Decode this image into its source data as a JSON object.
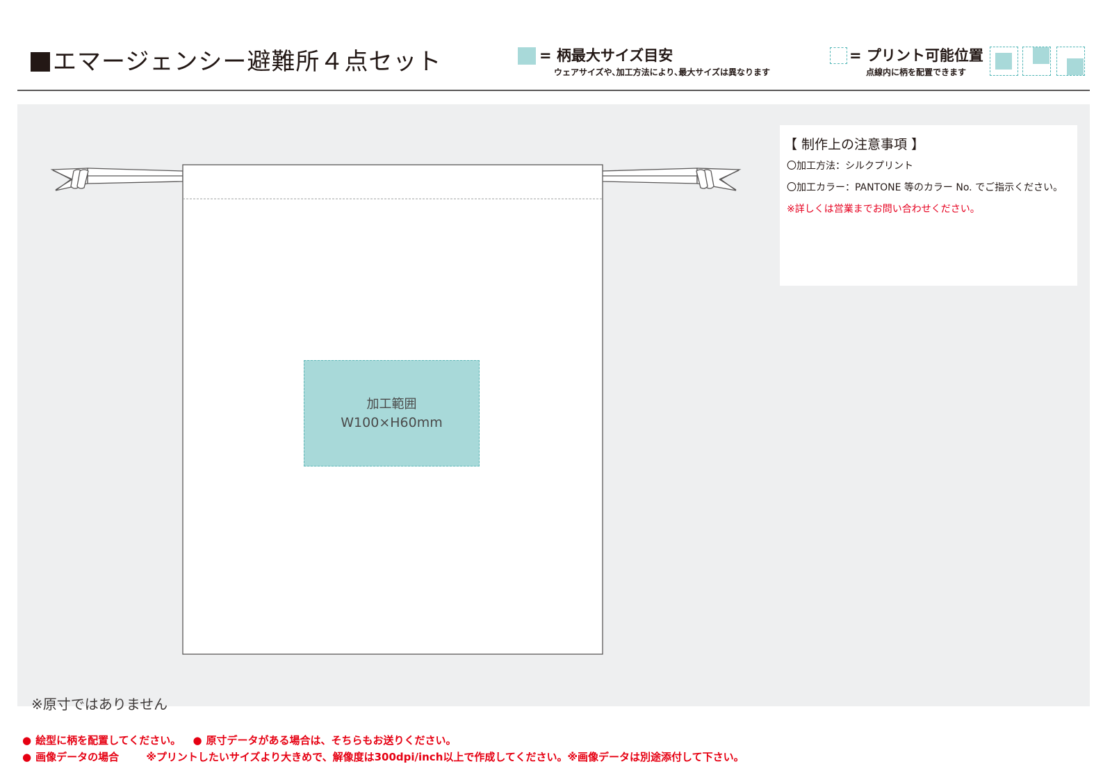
{
  "header": {
    "title": "エマージェンシー避難所４点セット",
    "legend_max": {
      "label": "= 柄最大サイズ目安",
      "note": "ウェアサイズや､加工方法により､最大サイズは異なります",
      "color": "#a8d9d9"
    },
    "legend_position": {
      "label": "= プリント可能位置",
      "note": "点線内に柄を配置できます"
    }
  },
  "template": {
    "print_area_label": "加工範囲",
    "print_area_size": "W100×H60mm"
  },
  "notes": {
    "title": "【 制作上の注意事項 】",
    "method": "〇加工方法：シルクプリント",
    "color_spec": "〇加工カラー：PANTONE 等のカラー No. でご指示ください。",
    "warning": "※詳しくは営業までお問い合わせください。"
  },
  "not_actual_size": "※原寸ではありません",
  "footer": {
    "bullet": "●",
    "line1_a": "絵型に柄を配置してください。",
    "line1_b": "原寸データがある場合は、そちらもお送りください。",
    "line2_a": "画像データの場合",
    "line2_b": "※プリントしたいサイズより大きめで、解像度は300dpi/inch以上で作成してください。※画像データは別途添付して下さい。"
  },
  "colors": {
    "accent": "#a8d9d9",
    "warning_red": "#e60012",
    "panel_bg": "#eeeff0"
  }
}
